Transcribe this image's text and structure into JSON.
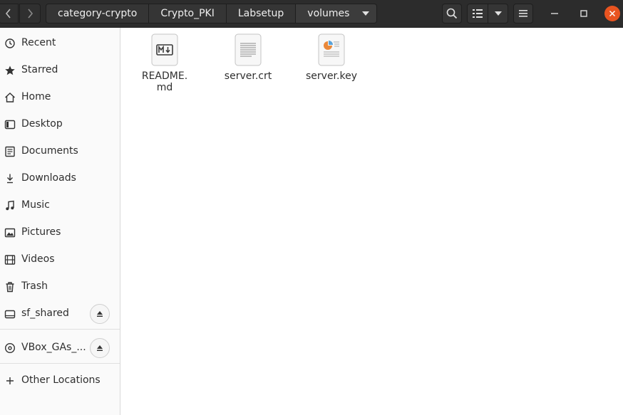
{
  "header": {
    "path": [
      "category-crypto",
      "Crypto_PKI",
      "Labsetup",
      "volumes"
    ],
    "icons": {
      "back": "chevron-left-icon",
      "forward": "chevron-right-icon",
      "search": "search-icon",
      "view": "list-view-icon",
      "view_menu": "caret-down-icon",
      "menu": "hamburger-menu-icon",
      "minimize": "minimize-icon",
      "maximize": "maximize-icon",
      "close": "close-icon"
    },
    "colors": {
      "bar": "#2c2c2c",
      "close": "#e95420"
    }
  },
  "sidebar": {
    "items": [
      {
        "label": "Recent",
        "icon": "clock-icon"
      },
      {
        "label": "Starred",
        "icon": "star-icon"
      },
      {
        "label": "Home",
        "icon": "home-icon"
      },
      {
        "label": "Desktop",
        "icon": "desktop-icon"
      },
      {
        "label": "Documents",
        "icon": "document-icon"
      },
      {
        "label": "Downloads",
        "icon": "download-icon"
      },
      {
        "label": "Music",
        "icon": "music-icon"
      },
      {
        "label": "Pictures",
        "icon": "picture-icon"
      },
      {
        "label": "Videos",
        "icon": "video-icon"
      },
      {
        "label": "Trash",
        "icon": "trash-icon"
      },
      {
        "label": "sf_shared",
        "icon": "drive-icon",
        "eject": true
      },
      {
        "label": "VBox_GAs_...",
        "icon": "optical-disc-icon",
        "eject": true
      },
      {
        "label": "Other Locations",
        "icon": "plus-icon"
      }
    ]
  },
  "files": [
    {
      "name": "README.\nmd",
      "icon": "markdown-file-icon"
    },
    {
      "name": "server.crt",
      "icon": "text-file-icon"
    },
    {
      "name": "server.key",
      "icon": "key-file-icon"
    }
  ]
}
